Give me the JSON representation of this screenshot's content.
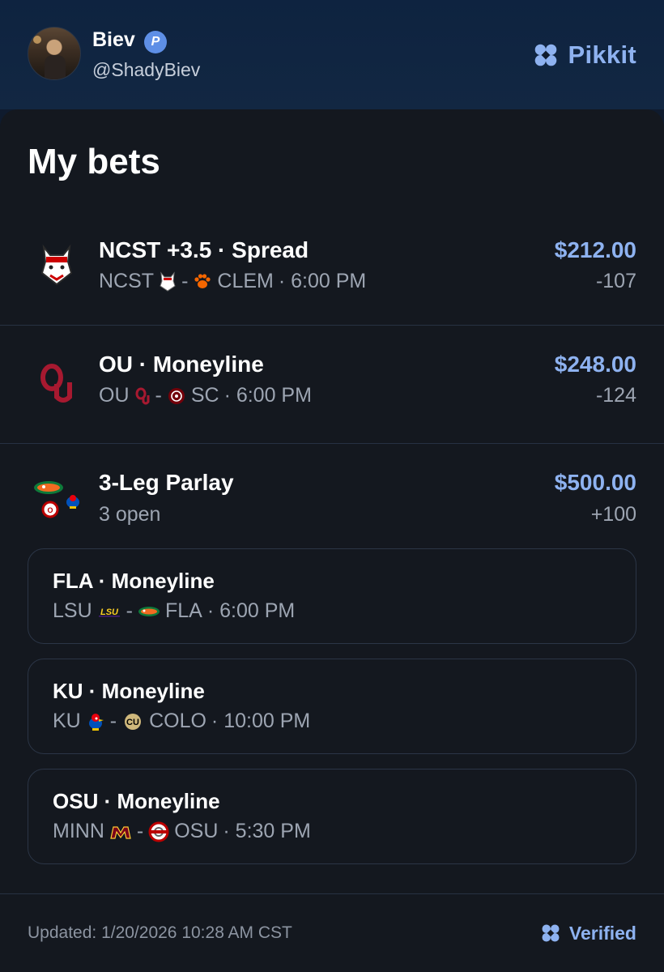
{
  "header": {
    "user_name": "Biev",
    "badge_letter": "P",
    "user_handle": "@ShadyBiev",
    "brand_name": "Pikkit"
  },
  "page_title": "My bets",
  "bets": [
    {
      "title": "NCST +3.5 · Spread",
      "team_a": "NCST",
      "team_b": "CLEM",
      "time": "· 6:00 PM",
      "amount": "$212.00",
      "odds": "-107"
    },
    {
      "title": "OU · Moneyline",
      "team_a": "OU",
      "team_b": "SC",
      "time": "· 6:00 PM",
      "amount": "$248.00",
      "odds": "-124"
    }
  ],
  "parlay": {
    "title": "3-Leg Parlay",
    "status": "3 open",
    "amount": "$500.00",
    "odds": "+100",
    "legs": [
      {
        "title": "FLA · Moneyline",
        "team_a": "LSU",
        "team_b": "FLA",
        "time": "· 6:00 PM"
      },
      {
        "title": "KU · Moneyline",
        "team_a": "KU",
        "team_b": "COLO",
        "time": "· 10:00 PM"
      },
      {
        "title": "OSU · Moneyline",
        "team_a": "MINN",
        "team_b": "OSU",
        "time": "· 5:30 PM"
      }
    ]
  },
  "separator": "-",
  "footer": {
    "updated": "Updated: 1/20/2026 10:28 AM CST",
    "verified": "Verified"
  },
  "colors": {
    "accent": "#8eb2f0",
    "background": "#14181f",
    "header": "#0f1b2e"
  }
}
